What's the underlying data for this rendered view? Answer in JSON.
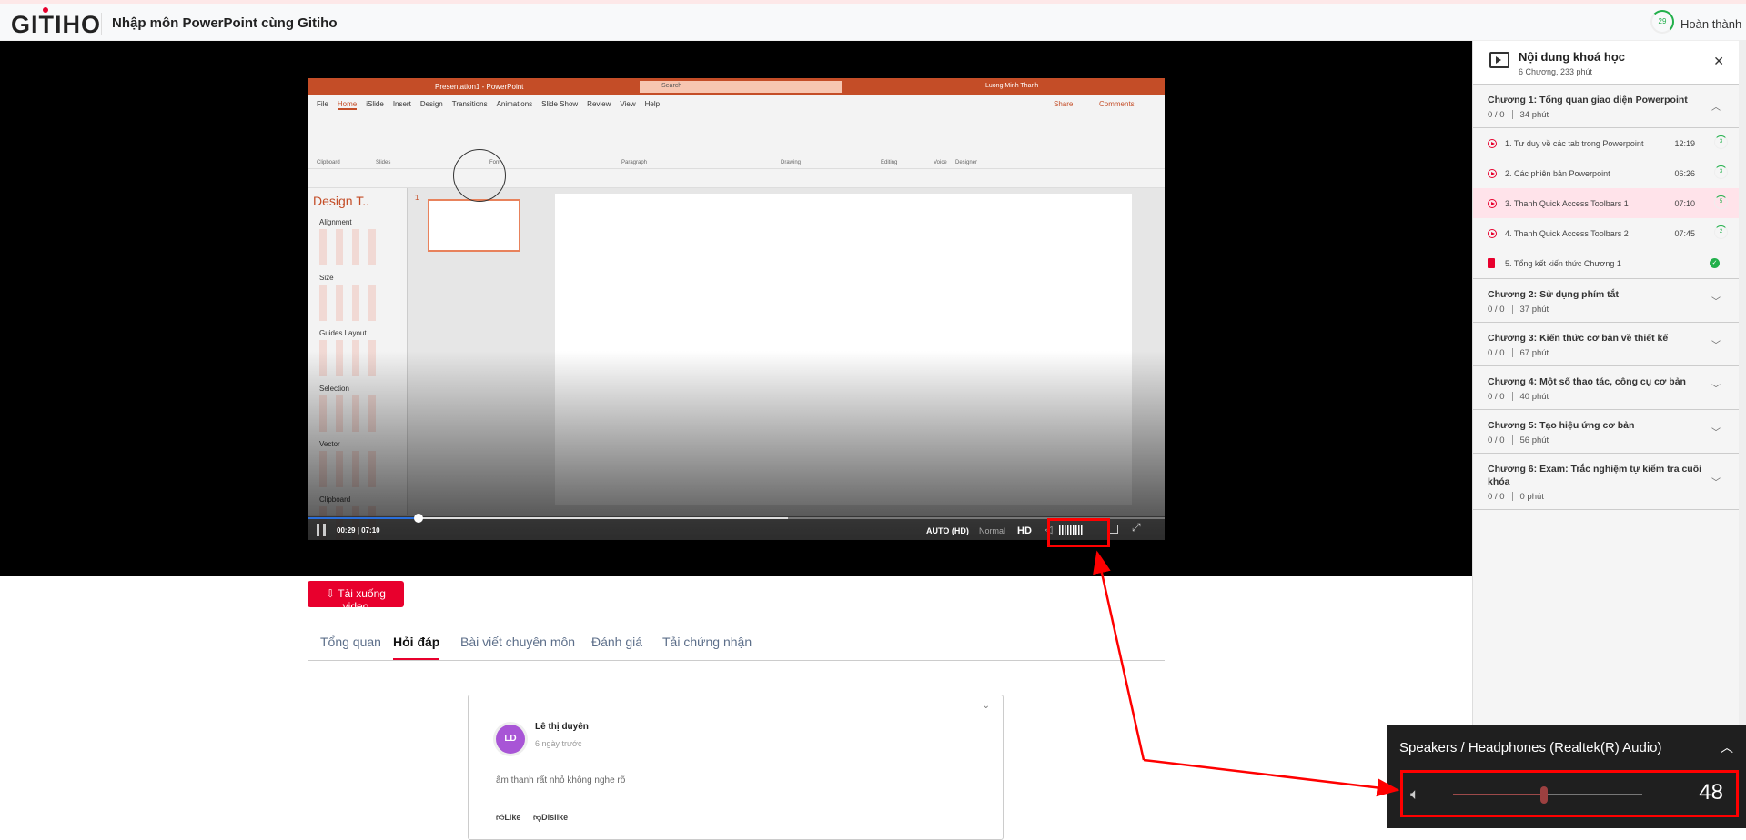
{
  "header": {
    "logo": "GITIHO",
    "course_title": "Nhập môn PowerPoint cùng Gitiho",
    "progress_value": "29",
    "complete_label": "Hoàn thành"
  },
  "ppt": {
    "window_title": "Presentation1 - PowerPoint",
    "search_placeholder": "Search",
    "user": "Luong Minh Thanh",
    "tabs": [
      "File",
      "Home",
      "iSlide",
      "Insert",
      "Design",
      "Transitions",
      "Animations",
      "Slide Show",
      "Review",
      "View",
      "Help"
    ],
    "groups": [
      "Clipboard",
      "Slides",
      "Font",
      "Paragraph",
      "Drawing",
      "Editing",
      "Voice",
      "Designer"
    ],
    "share": "Share",
    "comments": "Comments",
    "pane_title": "Design T..",
    "pane_sections": [
      "Alignment",
      "Size",
      "Guides Layout",
      "Selection",
      "Vector",
      "Clipboard"
    ],
    "slide_number": "1"
  },
  "player": {
    "current_time": "00:29",
    "duration": "07:10",
    "played_fraction": 0.13,
    "buffered_fraction": 0.56,
    "quality": "AUTO (HD)",
    "speed": "Normal",
    "hd": "HD"
  },
  "download_label": "Tải xuống video",
  "tabs": [
    {
      "label": "Tổng quan"
    },
    {
      "label": "Hỏi đáp",
      "active": true
    },
    {
      "label": "Bài viết chuyên môn"
    },
    {
      "label": "Đánh giá"
    },
    {
      "label": "Tải chứng nhận"
    }
  ],
  "comment": {
    "initials": "LD",
    "author": "Lê thị duyên",
    "time": "6 ngày trước",
    "text": "âm thanh rất nhỏ không nghe rõ",
    "like": "Like",
    "dislike": "Dislike"
  },
  "sidebar": {
    "title": "Nội dung khoá học",
    "subtitle": "6 Chương, 233 phút",
    "chapters": [
      {
        "name": "Chương 1: Tổng quan giao diện Powerpoint",
        "progress": "0 / 0",
        "duration": "34 phút",
        "expanded": true,
        "lessons": [
          {
            "title": "1. Tư duy về các tab trong Powerpoint",
            "duration": "12:19",
            "count": "3"
          },
          {
            "title": "2. Các phiên bản Powerpoint",
            "duration": "06:26",
            "count": "3"
          },
          {
            "title": "3. Thanh Quick Access Toolbars 1",
            "duration": "07:10",
            "count": "5",
            "active": true
          },
          {
            "title": "4. Thanh Quick Access Toolbars 2",
            "duration": "07:45",
            "count": "2"
          },
          {
            "title": "5. Tổng kết kiến thức Chương 1",
            "duration": "",
            "count": "",
            "done": true
          }
        ]
      },
      {
        "name": "Chương 2: Sử dụng phím tắt",
        "progress": "0 / 0",
        "duration": "37 phút"
      },
      {
        "name": "Chương 3: Kiến thức cơ bản về thiết kế",
        "progress": "0 / 0",
        "duration": "67 phút"
      },
      {
        "name": "Chương 4: Một số thao tác, công cụ cơ bản",
        "progress": "0 / 0",
        "duration": "40 phút"
      },
      {
        "name": "Chương 5: Tạo hiệu ứng cơ bản",
        "progress": "0 / 0",
        "duration": "56 phút"
      },
      {
        "name": "Chương 6: Exam: Trắc nghiệm tự kiểm tra cuối khóa",
        "progress": "0 / 0",
        "duration": "0 phút"
      }
    ]
  },
  "volume": {
    "device": "Speakers / Headphones (Realtek(R) Audio)",
    "level": 48
  },
  "colors": {
    "brand": "#e8002d",
    "annotation": "#ff0000",
    "ppt": "#c44d27"
  }
}
